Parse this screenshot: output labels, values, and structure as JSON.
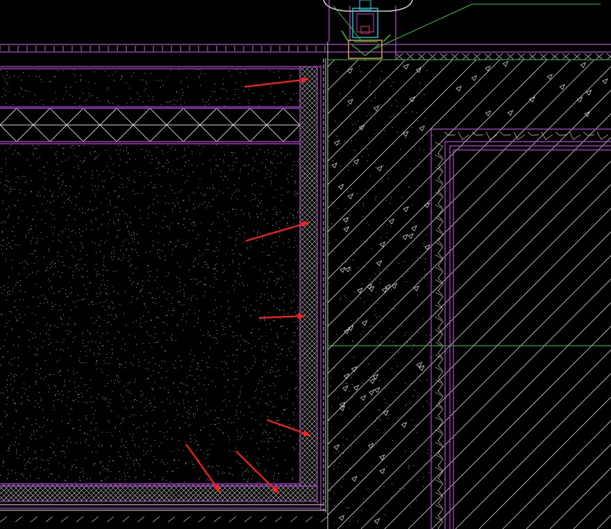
{
  "canvas": {
    "background": "#000000"
  },
  "colors": {
    "outline": "#c040e0",
    "hatch": "#d8d8d8",
    "speckle": "#ffffff",
    "guide": "#33cc33",
    "arrow": "#ff2020",
    "frame_cyan": "#00c8e0",
    "frame_orange": "#e0a040",
    "frame_red": "#ff3030"
  },
  "icons": {
    "pointer": "arrow-icon"
  },
  "annotations": {
    "arrow_count": 6
  }
}
